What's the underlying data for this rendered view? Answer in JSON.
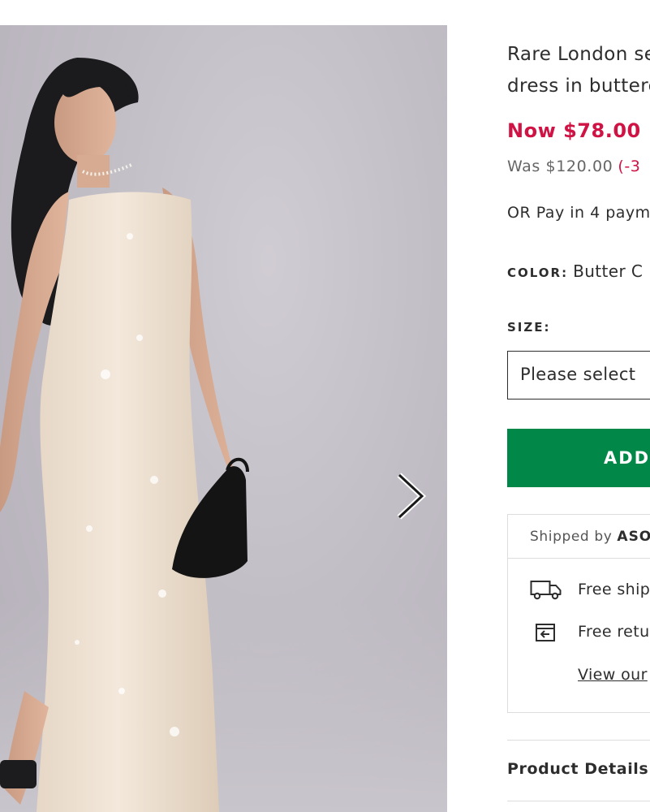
{
  "product": {
    "title_line1": "Rare London se",
    "title_line2": "dress in butterc",
    "price_now": "Now $78.00",
    "price_was": "Was $120.00",
    "price_discount": "(-3",
    "pay_text": "OR Pay in 4 paym",
    "color_label": "COLOR:",
    "color_value": "Butter C",
    "size_label": "SIZE:",
    "size_placeholder": "Please select",
    "add_button": "ADD",
    "accent_green": "#018849",
    "accent_red": "#d01345"
  },
  "shipping": {
    "shipped_by_prefix": "Shipped by",
    "shipped_by_brand": "ASO",
    "free_shipping": "Free shipp",
    "free_returns": "Free retur",
    "view_link": "View our"
  },
  "accordion": {
    "product_details": "Product Details"
  },
  "gallery": {
    "next_icon": "chevron-right-icon"
  }
}
